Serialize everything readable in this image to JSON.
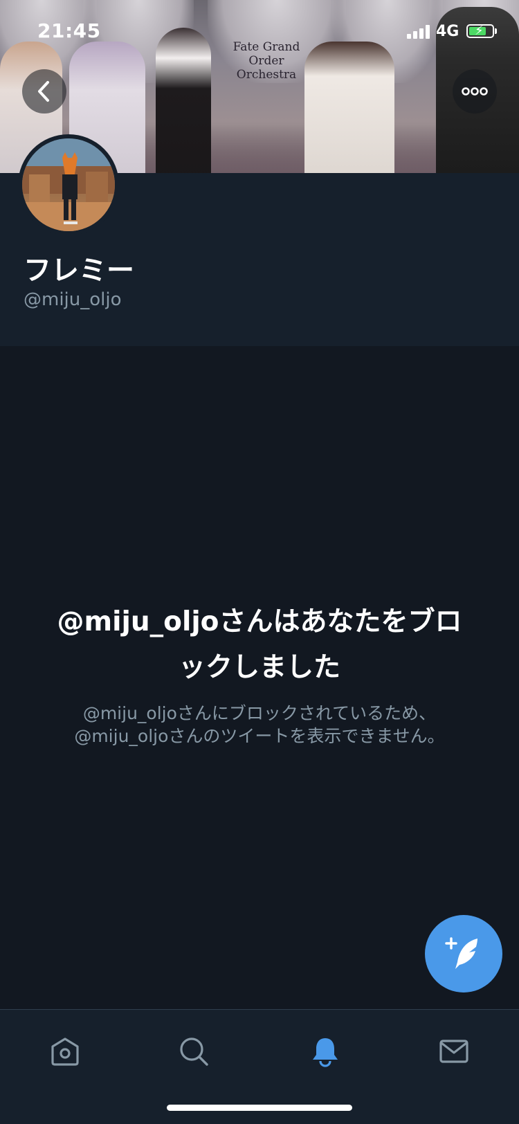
{
  "status_bar": {
    "time": "21:45",
    "network": "4G",
    "battery_color": "#4cd964"
  },
  "banner": {
    "logo_line1": "Fate Grand Order",
    "logo_line2": "Orchestra"
  },
  "nav": {
    "back_icon": "chevron-left-icon",
    "more_icon": "ellipsis-icon"
  },
  "profile": {
    "display_name": "フレミー",
    "handle": "@miju_oljo"
  },
  "blocked": {
    "title": "@miju_oljoさんはあなたをブロックしました",
    "description": "@miju_oljoさんにブロックされているため、@miju_oljoさんのツイートを表示できません。"
  },
  "compose": {
    "icon": "compose-tweet-icon",
    "color": "#4a99e9"
  },
  "tab_bar": {
    "items": [
      {
        "name": "home",
        "icon": "home-icon",
        "active": false
      },
      {
        "name": "search",
        "icon": "search-icon",
        "active": false
      },
      {
        "name": "notifications",
        "icon": "bell-icon",
        "active": true
      },
      {
        "name": "messages",
        "icon": "mail-icon",
        "active": false
      }
    ],
    "active_color": "#4a99e9",
    "inactive_color": "#8899a6"
  }
}
